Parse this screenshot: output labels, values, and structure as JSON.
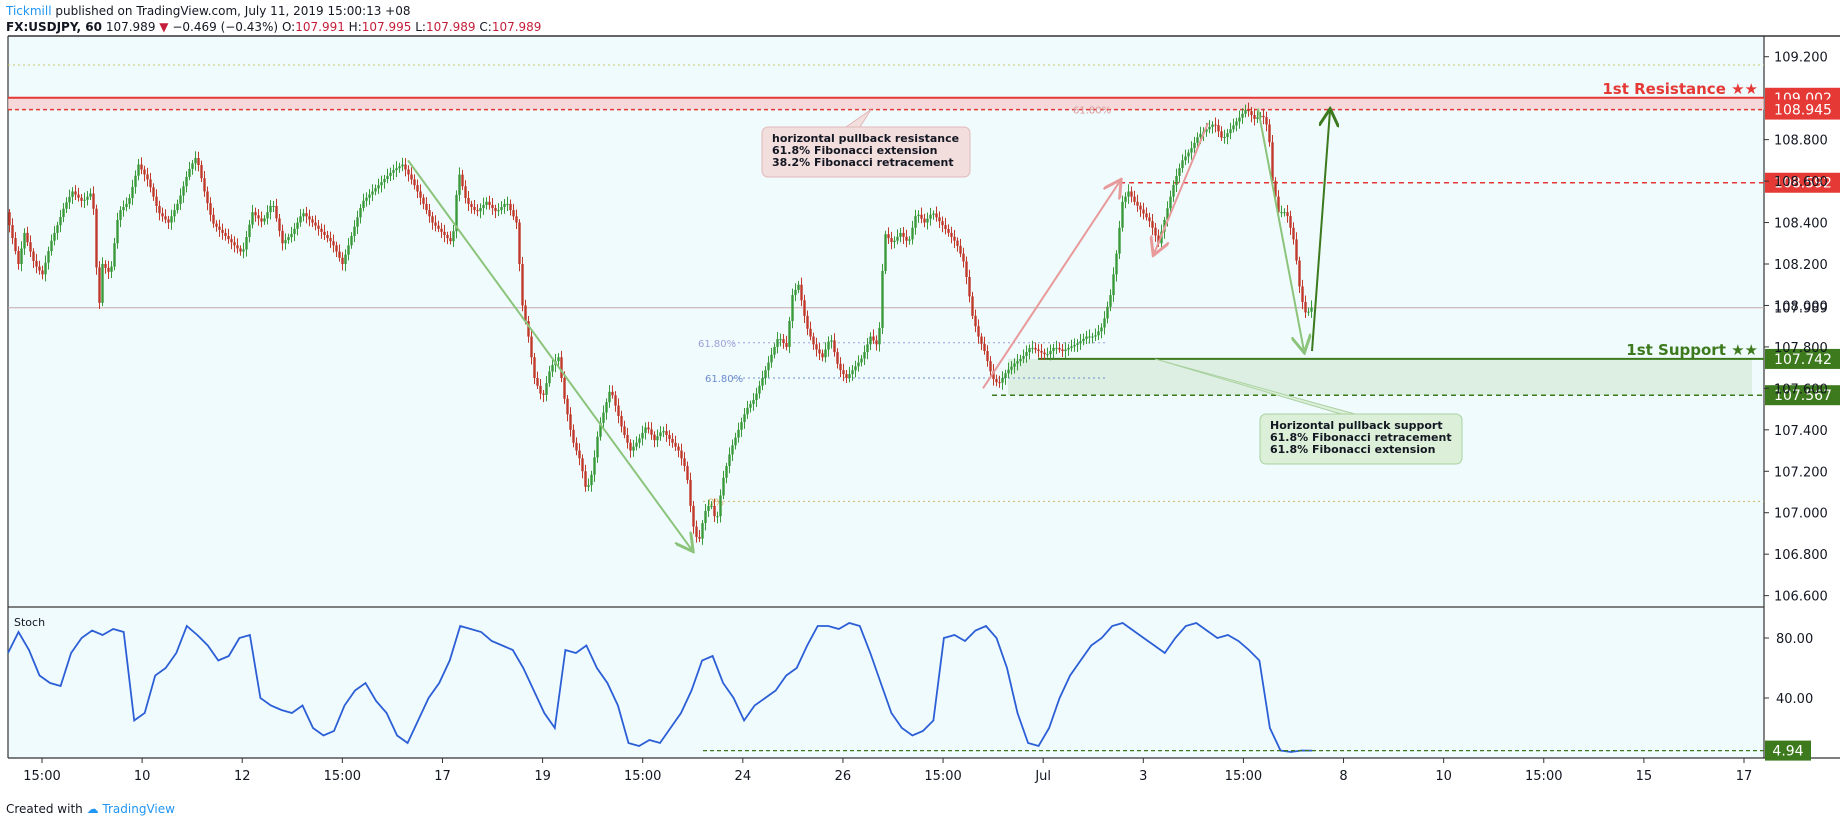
{
  "header": {
    "publisher": "Tickmill",
    "published_text": "published on TradingView.com, July 11, 2019 15:00:13 +08",
    "symbol": "FX:USDJPY, 60",
    "last": "107.989",
    "change": "−0.469 (−0.43%)",
    "o_label": "O:",
    "o_value": "107.991",
    "h_label": "H:",
    "h_value": "107.995",
    "l_label": "L:",
    "l_value": "107.989",
    "c_label": "C:",
    "c_value": "107.989"
  },
  "footer": {
    "created_with": "Created with",
    "brand": "TradingView"
  },
  "colors": {
    "background": "#f0fbfe",
    "up": "#3a9a3a",
    "down": "#c0392b",
    "resistance": "#e53935",
    "support": "#3d7a1e",
    "stoch": "#2c5fd6",
    "arrow_green": "#8bc47a",
    "arrow_red": "#e89a9a"
  },
  "chart_data": [
    {
      "type": "candlestick",
      "title": "USDJPY",
      "x_ticks": [
        "15:00",
        "10",
        "12",
        "15:00",
        "17",
        "19",
        "15:00",
        "24",
        "26",
        "15:00",
        "Jul",
        "3",
        "15:00",
        "8",
        "10",
        "15:00",
        "15",
        "17"
      ],
      "y_ticks": [
        "109.200",
        "108.800",
        "108.600",
        "108.400",
        "108.200",
        "108.000",
        "107.800",
        "107.600",
        "107.400",
        "107.200",
        "107.000",
        "106.800",
        "106.600"
      ],
      "ylim": [
        106.55,
        109.3
      ],
      "close_path": [
        {
          "x": 0,
          "y": 108.45
        },
        {
          "x": 12,
          "y": 108.2
        },
        {
          "x": 18,
          "y": 108.35
        },
        {
          "x": 28,
          "y": 108.2
        },
        {
          "x": 36,
          "y": 108.15
        },
        {
          "x": 44,
          "y": 108.3
        },
        {
          "x": 52,
          "y": 108.4
        },
        {
          "x": 58,
          "y": 108.48
        },
        {
          "x": 66,
          "y": 108.55
        },
        {
          "x": 76,
          "y": 108.5
        },
        {
          "x": 86,
          "y": 108.55
        },
        {
          "x": 89,
          "y": 108.3
        },
        {
          "x": 92,
          "y": 107.95
        },
        {
          "x": 96,
          "y": 108.2
        },
        {
          "x": 104,
          "y": 108.15
        },
        {
          "x": 112,
          "y": 108.45
        },
        {
          "x": 122,
          "y": 108.5
        },
        {
          "x": 132,
          "y": 108.68
        },
        {
          "x": 142,
          "y": 108.6
        },
        {
          "x": 152,
          "y": 108.45
        },
        {
          "x": 162,
          "y": 108.4
        },
        {
          "x": 172,
          "y": 108.5
        },
        {
          "x": 182,
          "y": 108.65
        },
        {
          "x": 190,
          "y": 108.72
        },
        {
          "x": 198,
          "y": 108.55
        },
        {
          "x": 206,
          "y": 108.4
        },
        {
          "x": 216,
          "y": 108.35
        },
        {
          "x": 226,
          "y": 108.3
        },
        {
          "x": 236,
          "y": 108.25
        },
        {
          "x": 246,
          "y": 108.45
        },
        {
          "x": 256,
          "y": 108.4
        },
        {
          "x": 266,
          "y": 108.5
        },
        {
          "x": 276,
          "y": 108.3
        },
        {
          "x": 286,
          "y": 108.35
        },
        {
          "x": 296,
          "y": 108.45
        },
        {
          "x": 306,
          "y": 108.4
        },
        {
          "x": 316,
          "y": 108.35
        },
        {
          "x": 326,
          "y": 108.3
        },
        {
          "x": 336,
          "y": 108.2
        },
        {
          "x": 346,
          "y": 108.35
        },
        {
          "x": 356,
          "y": 108.5
        },
        {
          "x": 366,
          "y": 108.55
        },
        {
          "x": 376,
          "y": 108.6
        },
        {
          "x": 386,
          "y": 108.65
        },
        {
          "x": 396,
          "y": 108.68
        },
        {
          "x": 406,
          "y": 108.6
        },
        {
          "x": 416,
          "y": 108.5
        },
        {
          "x": 426,
          "y": 108.4
        },
        {
          "x": 436,
          "y": 108.35
        },
        {
          "x": 446,
          "y": 108.3
        },
        {
          "x": 452,
          "y": 108.65
        },
        {
          "x": 460,
          "y": 108.5
        },
        {
          "x": 470,
          "y": 108.45
        },
        {
          "x": 480,
          "y": 108.5
        },
        {
          "x": 490,
          "y": 108.45
        },
        {
          "x": 500,
          "y": 108.5
        },
        {
          "x": 510,
          "y": 108.4
        },
        {
          "x": 516,
          "y": 108.0
        },
        {
          "x": 522,
          "y": 107.85
        },
        {
          "x": 528,
          "y": 107.65
        },
        {
          "x": 536,
          "y": 107.55
        },
        {
          "x": 544,
          "y": 107.7
        },
        {
          "x": 552,
          "y": 107.75
        },
        {
          "x": 558,
          "y": 107.55
        },
        {
          "x": 566,
          "y": 107.35
        },
        {
          "x": 574,
          "y": 107.25
        },
        {
          "x": 580,
          "y": 107.1
        },
        {
          "x": 586,
          "y": 107.2
        },
        {
          "x": 592,
          "y": 107.4
        },
        {
          "x": 598,
          "y": 107.5
        },
        {
          "x": 604,
          "y": 107.6
        },
        {
          "x": 610,
          "y": 107.5
        },
        {
          "x": 616,
          "y": 107.4
        },
        {
          "x": 624,
          "y": 107.3
        },
        {
          "x": 632,
          "y": 107.35
        },
        {
          "x": 640,
          "y": 107.42
        },
        {
          "x": 648,
          "y": 107.35
        },
        {
          "x": 656,
          "y": 107.4
        },
        {
          "x": 664,
          "y": 107.35
        },
        {
          "x": 672,
          "y": 107.3
        },
        {
          "x": 680,
          "y": 107.2
        },
        {
          "x": 686,
          "y": 106.95
        },
        {
          "x": 692,
          "y": 106.85
        },
        {
          "x": 698,
          "y": 107.0
        },
        {
          "x": 704,
          "y": 107.05
        },
        {
          "x": 710,
          "y": 106.95
        },
        {
          "x": 716,
          "y": 107.15
        },
        {
          "x": 724,
          "y": 107.3
        },
        {
          "x": 732,
          "y": 107.4
        },
        {
          "x": 740,
          "y": 107.5
        },
        {
          "x": 748,
          "y": 107.55
        },
        {
          "x": 756,
          "y": 107.65
        },
        {
          "x": 764,
          "y": 107.75
        },
        {
          "x": 772,
          "y": 107.85
        },
        {
          "x": 780,
          "y": 107.8
        },
        {
          "x": 786,
          "y": 108.05
        },
        {
          "x": 792,
          "y": 108.1
        },
        {
          "x": 800,
          "y": 107.9
        },
        {
          "x": 808,
          "y": 107.8
        },
        {
          "x": 816,
          "y": 107.75
        },
        {
          "x": 824,
          "y": 107.85
        },
        {
          "x": 832,
          "y": 107.7
        },
        {
          "x": 840,
          "y": 107.65
        },
        {
          "x": 848,
          "y": 107.7
        },
        {
          "x": 856,
          "y": 107.75
        },
        {
          "x": 864,
          "y": 107.85
        },
        {
          "x": 872,
          "y": 107.8
        },
        {
          "x": 878,
          "y": 108.35
        },
        {
          "x": 886,
          "y": 108.3
        },
        {
          "x": 894,
          "y": 108.35
        },
        {
          "x": 902,
          "y": 108.3
        },
        {
          "x": 910,
          "y": 108.45
        },
        {
          "x": 918,
          "y": 108.4
        },
        {
          "x": 926,
          "y": 108.45
        },
        {
          "x": 934,
          "y": 108.4
        },
        {
          "x": 942,
          "y": 108.35
        },
        {
          "x": 950,
          "y": 108.3
        },
        {
          "x": 958,
          "y": 108.2
        },
        {
          "x": 966,
          "y": 107.95
        },
        {
          "x": 972,
          "y": 107.85
        },
        {
          "x": 978,
          "y": 107.78
        },
        {
          "x": 986,
          "y": 107.65
        },
        {
          "x": 992,
          "y": 107.62
        },
        {
          "x": 1000,
          "y": 107.68
        },
        {
          "x": 1008,
          "y": 107.72
        },
        {
          "x": 1016,
          "y": 107.75
        },
        {
          "x": 1024,
          "y": 107.8
        },
        {
          "x": 1032,
          "y": 107.78
        },
        {
          "x": 1040,
          "y": 107.76
        },
        {
          "x": 1048,
          "y": 107.8
        },
        {
          "x": 1056,
          "y": 107.78
        },
        {
          "x": 1064,
          "y": 107.8
        },
        {
          "x": 1072,
          "y": 107.82
        },
        {
          "x": 1080,
          "y": 107.85
        },
        {
          "x": 1088,
          "y": 107.85
        },
        {
          "x": 1096,
          "y": 107.9
        },
        {
          "x": 1104,
          "y": 108.05
        },
        {
          "x": 1110,
          "y": 108.25
        },
        {
          "x": 1116,
          "y": 108.5
        },
        {
          "x": 1122,
          "y": 108.55
        },
        {
          "x": 1128,
          "y": 108.5
        },
        {
          "x": 1136,
          "y": 108.45
        },
        {
          "x": 1144,
          "y": 108.4
        },
        {
          "x": 1152,
          "y": 108.3
        },
        {
          "x": 1160,
          "y": 108.45
        },
        {
          "x": 1168,
          "y": 108.6
        },
        {
          "x": 1176,
          "y": 108.7
        },
        {
          "x": 1184,
          "y": 108.75
        },
        {
          "x": 1192,
          "y": 108.82
        },
        {
          "x": 1200,
          "y": 108.85
        },
        {
          "x": 1208,
          "y": 108.88
        },
        {
          "x": 1216,
          "y": 108.8
        },
        {
          "x": 1224,
          "y": 108.85
        },
        {
          "x": 1232,
          "y": 108.9
        },
        {
          "x": 1240,
          "y": 108.95
        },
        {
          "x": 1248,
          "y": 108.9
        },
        {
          "x": 1256,
          "y": 108.92
        },
        {
          "x": 1262,
          "y": 108.85
        },
        {
          "x": 1266,
          "y": 108.6
        },
        {
          "x": 1272,
          "y": 108.45
        },
        {
          "x": 1280,
          "y": 108.45
        },
        {
          "x": 1288,
          "y": 108.3
        },
        {
          "x": 1294,
          "y": 108.05
        },
        {
          "x": 1300,
          "y": 107.95
        },
        {
          "x": 1304,
          "y": 107.99
        }
      ],
      "levels": [
        {
          "label": "1st Resistance ★★",
          "price": "109.002",
          "value": 109.002
        },
        {
          "price": "108.945",
          "value": 108.945
        },
        {
          "price": "108.592",
          "value": 108.592
        },
        {
          "label": "1st Support ★★",
          "price": "107.742",
          "value": 107.742
        },
        {
          "price": "107.567",
          "value": 107.567
        }
      ],
      "fib_labels": [
        {
          "text": "61.80%",
          "value": 107.82
        },
        {
          "text": "61.80%",
          "value": 107.65
        },
        {
          "text": "61.80%",
          "value": 108.945
        },
        {
          "text": "0%",
          "value": 107.055
        }
      ],
      "annotations": [
        {
          "lines": [
            "horizontal pullback resistance",
            "61.8% Fibonacci extension",
            "38.2% Fibonacci retracement"
          ]
        },
        {
          "lines": [
            "Horizontal pullback support",
            "61.8% Fibonacci retracement",
            "61.8% Fibonacci extension"
          ]
        }
      ],
      "last_price": 107.989
    },
    {
      "type": "line",
      "title": "Stoch",
      "y_ticks": [
        "80.00",
        "40.00"
      ],
      "ylim": [
        0,
        100
      ],
      "last_value": "4.94",
      "series": [
        {
          "values": [
            70,
            84,
            72,
            55,
            50,
            48,
            70,
            80,
            85,
            82,
            86,
            84,
            25,
            30,
            55,
            60,
            70,
            88,
            82,
            75,
            65,
            68,
            80,
            82,
            40,
            35,
            32,
            30,
            35,
            20,
            15,
            18,
            35,
            45,
            50,
            38,
            30,
            15,
            10,
            25,
            40,
            50,
            65,
            88,
            86,
            84,
            78,
            75,
            72,
            60,
            45,
            30,
            20,
            72,
            70,
            75,
            60,
            50,
            35,
            10,
            8,
            12,
            10,
            20,
            30,
            45,
            65,
            68,
            50,
            40,
            25,
            35,
            40,
            45,
            55,
            60,
            75,
            88,
            88,
            86,
            90,
            88,
            70,
            50,
            30,
            20,
            15,
            18,
            25,
            80,
            82,
            78,
            85,
            88,
            80,
            60,
            30,
            10,
            8,
            20,
            40,
            55,
            65,
            75,
            80,
            88,
            90,
            85,
            80,
            75,
            70,
            80,
            88,
            90,
            85,
            80,
            82,
            78,
            72,
            65,
            20,
            5,
            4,
            5,
            4.94
          ]
        }
      ]
    }
  ]
}
